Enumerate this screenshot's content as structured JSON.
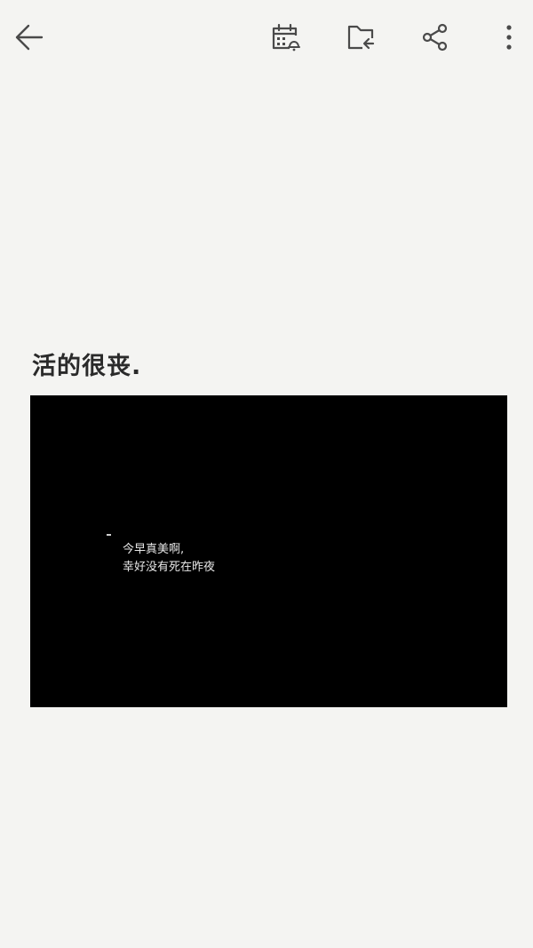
{
  "toolbar": {
    "back": {
      "icon": "arrow-left-icon"
    },
    "reminder": {
      "icon": "calendar-alarm-icon"
    },
    "move": {
      "icon": "folder-move-icon"
    },
    "share": {
      "icon": "share-icon"
    },
    "more": {
      "icon": "more-vertical-icon"
    },
    "icon_color": "#4a4a4a"
  },
  "note": {
    "title": "活的很丧.",
    "image": {
      "lines": [
        "今早真美啊,",
        "幸好没有死在昨夜"
      ],
      "background": "#000000"
    }
  },
  "colors": {
    "page_background": "#f4f4f2",
    "title_text": "#2a2a2a"
  }
}
